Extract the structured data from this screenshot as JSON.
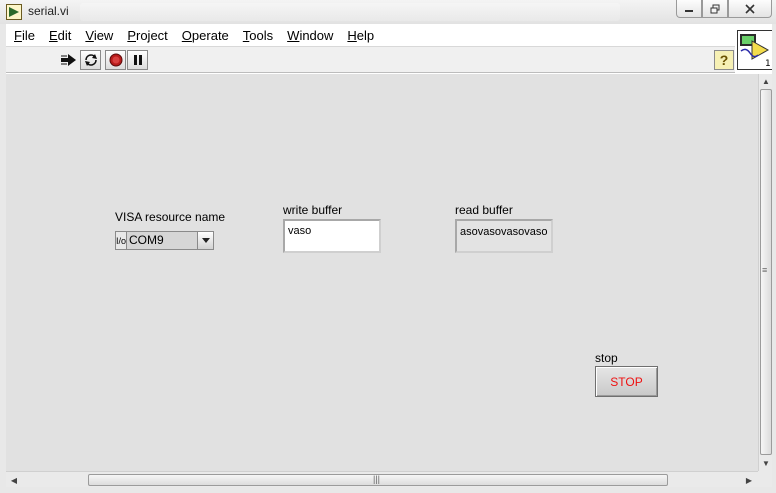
{
  "window": {
    "title": "serial.vi"
  },
  "menu": {
    "items": [
      {
        "mnemonic": "F",
        "rest": "ile"
      },
      {
        "mnemonic": "E",
        "rest": "dit"
      },
      {
        "mnemonic": "V",
        "rest": "iew"
      },
      {
        "mnemonic": "P",
        "rest": "roject"
      },
      {
        "mnemonic": "O",
        "rest": "perate"
      },
      {
        "mnemonic": "T",
        "rest": "ools"
      },
      {
        "mnemonic": "W",
        "rest": "indow"
      },
      {
        "mnemonic": "H",
        "rest": "elp"
      }
    ]
  },
  "toolbar": {
    "icons": [
      "run-arrow-icon",
      "run-continuously-icon",
      "abort-icon",
      "pause-icon"
    ],
    "help_glyph": "?"
  },
  "vi_icon": {
    "number": "1"
  },
  "panel": {
    "visa": {
      "label": "VISA resource name",
      "prefix": "I/o",
      "value": "COM9"
    },
    "write_buffer": {
      "label": "write buffer",
      "value": "vaso"
    },
    "read_buffer": {
      "label": "read buffer",
      "value": "asovasovasovaso"
    },
    "stop": {
      "label": "stop",
      "button_text": "STOP",
      "text_color": "#ee1111"
    }
  },
  "colors": {
    "panel_bg": "#e1e1e1",
    "accent_help": "#f6f0b4"
  }
}
